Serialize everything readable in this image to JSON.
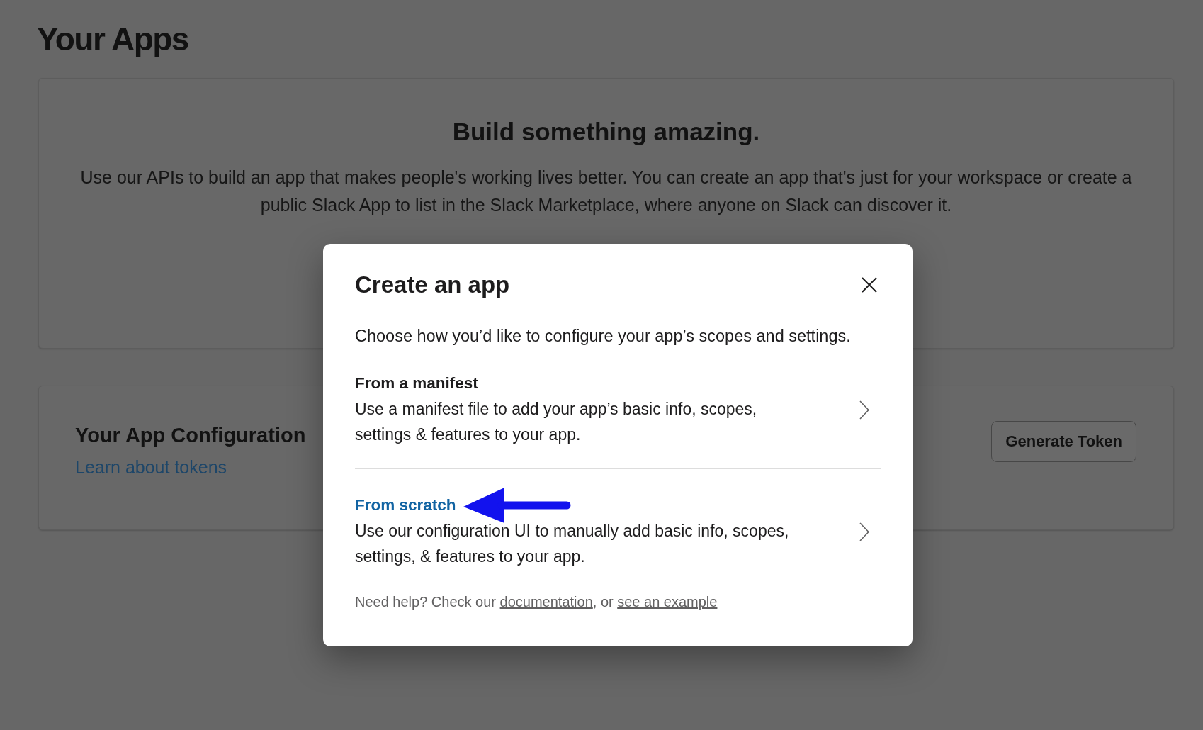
{
  "page": {
    "title": "Your Apps"
  },
  "intro_card": {
    "heading": "Build something amazing.",
    "text": "Use our APIs to build an app that makes people's working lives better. You can create an app that's just for your workspace or create a public Slack App to list in the Slack Marketplace, where anyone on Slack can discover it."
  },
  "token_card": {
    "title": "Your App Configuration",
    "link": "Learn about tokens",
    "button": "Generate Token"
  },
  "dialog": {
    "title": "Create an app",
    "subtitle": "Choose how you’d like to configure your app’s scopes and settings.",
    "options": [
      {
        "title": "From a manifest",
        "description": "Use a manifest file to add your app’s basic info, scopes, settings & features to your app.",
        "hovered": false,
        "arrow": false
      },
      {
        "title": "From scratch",
        "description": "Use our configuration UI to manually add basic info, scopes, settings, & features to your app.",
        "hovered": true,
        "arrow": true
      }
    ],
    "help": [
      {
        "kind": "text",
        "text": "Need help? Check our "
      },
      {
        "kind": "link",
        "text": "documentation"
      },
      {
        "kind": "text",
        "text": ", or "
      },
      {
        "kind": "link",
        "text": "see an example"
      }
    ]
  }
}
